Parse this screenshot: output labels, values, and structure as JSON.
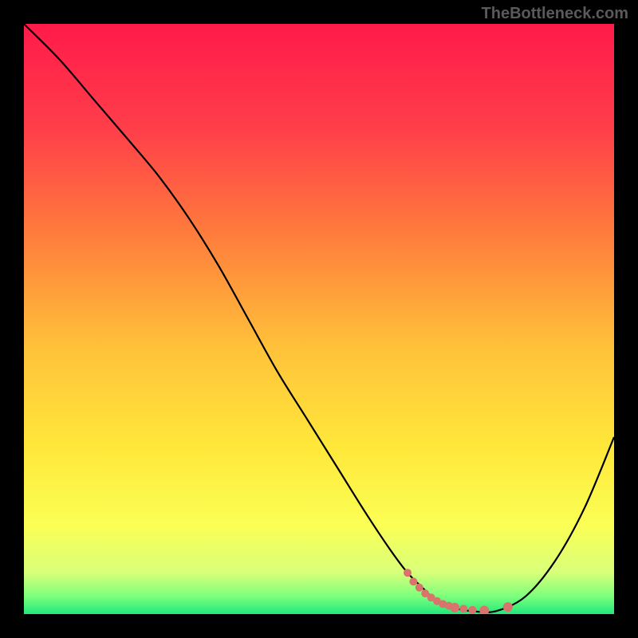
{
  "watermark": "TheBottleneck.com",
  "chart_data": {
    "type": "line",
    "title": "",
    "xlabel": "",
    "ylabel": "",
    "xlim": [
      0,
      100
    ],
    "ylim": [
      0,
      100
    ],
    "gradient_stops": [
      {
        "offset": 0,
        "color": "#ff1a4a"
      },
      {
        "offset": 18,
        "color": "#ff3f4a"
      },
      {
        "offset": 35,
        "color": "#ff7a3c"
      },
      {
        "offset": 55,
        "color": "#ffc23a"
      },
      {
        "offset": 72,
        "color": "#ffe83a"
      },
      {
        "offset": 85,
        "color": "#fbff55"
      },
      {
        "offset": 93,
        "color": "#d8ff7a"
      },
      {
        "offset": 97,
        "color": "#7cff7c"
      },
      {
        "offset": 100,
        "color": "#20e87c"
      }
    ],
    "series": [
      {
        "name": "bottleneck-curve",
        "color": "#000000",
        "width": 2.2,
        "x": [
          0,
          6,
          12,
          18,
          23,
          28,
          33,
          38,
          43,
          48,
          53,
          58,
          62,
          65,
          68,
          70,
          73,
          76,
          80,
          85,
          90,
          95,
          100
        ],
        "y": [
          100,
          94,
          87,
          80,
          74,
          67,
          59,
          50,
          41,
          33,
          25,
          17,
          11,
          7,
          4,
          2,
          1,
          0.5,
          0.5,
          3,
          9,
          18,
          30
        ]
      }
    ],
    "markers": {
      "name": "highlight-dots",
      "color": "#d9736b",
      "x": [
        65,
        66,
        67,
        68,
        69,
        70,
        71,
        72,
        73,
        74.5,
        76,
        78,
        82
      ],
      "y": [
        7,
        5.5,
        4.5,
        3.5,
        2.8,
        2.2,
        1.7,
        1.4,
        1.1,
        0.9,
        0.7,
        0.6,
        1.2
      ],
      "r": [
        5,
        5,
        5,
        5,
        5,
        5,
        5,
        5,
        6,
        5,
        5,
        6,
        6
      ]
    }
  }
}
